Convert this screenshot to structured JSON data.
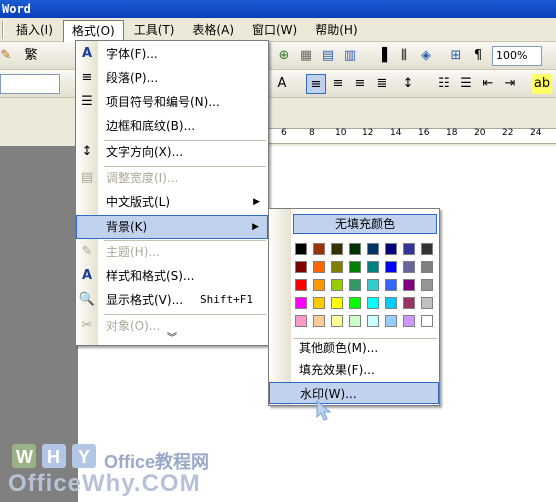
{
  "window": {
    "title": "Word"
  },
  "menubar": {
    "items": [
      {
        "label": "插入(I)"
      },
      {
        "label": "格式(O)"
      },
      {
        "label": "工具(T)"
      },
      {
        "label": "表格(A)"
      },
      {
        "label": "窗口(W)"
      },
      {
        "label": "帮助(H)"
      }
    ]
  },
  "toolbar": {
    "zoom_value": "100%",
    "font_fragment": "繁"
  },
  "ruler": {
    "numbers": [
      "6",
      "8",
      "10",
      "12",
      "14",
      "16",
      "18",
      "20",
      "22",
      "24"
    ]
  },
  "format_menu": {
    "items": [
      {
        "label": "字体(F)...",
        "icon": "A"
      },
      {
        "label": "段落(P)...",
        "icon": "≡"
      },
      {
        "label": "项目符号和编号(N)...",
        "icon": "☰"
      },
      {
        "label": "边框和底纹(B)...",
        "icon": ""
      },
      {
        "label": "文字方向(X)...",
        "icon": "↕"
      },
      {
        "label": "调整宽度(I)...",
        "icon": "▤"
      },
      {
        "label": "中文版式(L)",
        "icon": ""
      },
      {
        "label": "背景(K)",
        "icon": ""
      },
      {
        "label": "主题(H)...",
        "icon": "✎"
      },
      {
        "label": "样式和格式(S)...",
        "icon": "A"
      },
      {
        "label": "显示格式(V)...",
        "icon": "🔍",
        "shortcut": "Shift+F1"
      },
      {
        "label": "对象(O)...",
        "icon": "✂"
      }
    ]
  },
  "background_menu": {
    "no_fill": "无填充颜色",
    "more_colors": "其他颜色(M)...",
    "fill_effects": "填充效果(F)...",
    "watermark": "水印(W)...",
    "colors": [
      [
        "#000000",
        "#993300",
        "#333300",
        "#003300",
        "#003366",
        "#000080",
        "#333399",
        "#333333"
      ],
      [
        "#800000",
        "#ff6600",
        "#808000",
        "#008000",
        "#008080",
        "#0000ff",
        "#666699",
        "#808080"
      ],
      [
        "#ff0000",
        "#ff9900",
        "#99cc00",
        "#339966",
        "#33cccc",
        "#3366ff",
        "#800080",
        "#969696"
      ],
      [
        "#ff00ff",
        "#ffcc00",
        "#ffff00",
        "#00ff00",
        "#00ffff",
        "#00ccff",
        "#993366",
        "#c0c0c0"
      ],
      [
        "#ff99cc",
        "#ffcc99",
        "#ffff99",
        "#ccffcc",
        "#ccffff",
        "#99ccff",
        "#cc99ff",
        "#ffffff"
      ]
    ]
  },
  "watermark_logo": {
    "cn": "Office教程网",
    "en": "OfficeWhy.COM"
  }
}
